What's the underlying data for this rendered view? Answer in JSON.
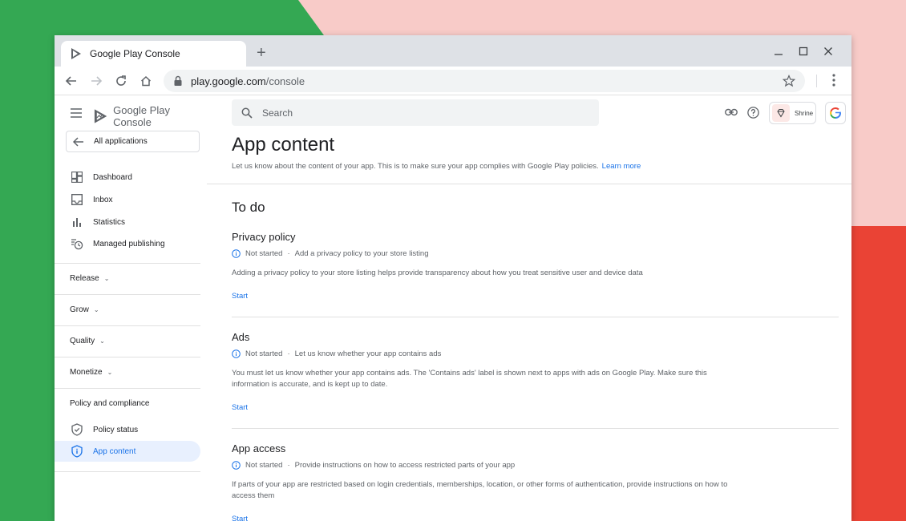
{
  "browser": {
    "tab_title": "Google Play Console",
    "url_host": "play.google.com",
    "url_path": "/console"
  },
  "sidebar": {
    "brand_prefix": "Google Play",
    "brand_suffix": "Console",
    "all_apps": "All applications",
    "top_items": [
      {
        "label": "Dashboard",
        "icon": "dashboard-icon"
      },
      {
        "label": "Inbox",
        "icon": "inbox-icon"
      },
      {
        "label": "Statistics",
        "icon": "bar-chart-icon"
      },
      {
        "label": "Managed publishing",
        "icon": "schedule-icon"
      }
    ],
    "sections": [
      "Release",
      "Grow",
      "Quality",
      "Monetize"
    ],
    "policy_section": "Policy and compliance",
    "policy_items": [
      {
        "label": "Policy status",
        "icon": "shield-check-icon"
      },
      {
        "label": "App content",
        "icon": "shield-info-icon",
        "active": true
      }
    ]
  },
  "header": {
    "search_placeholder": "Search",
    "account_name": "Shrine"
  },
  "main": {
    "title": "App content",
    "description": "Let us know about the content of your app. This is to make sure your app complies with Google Play policies.",
    "learn_more": "Learn more",
    "todo_heading": "To do",
    "cards": [
      {
        "title": "Privacy policy",
        "status": "Not started",
        "summary": "Add a privacy policy to your store listing",
        "description": "Adding a privacy policy to your store listing helps provide transparency about how you treat sensitive user and device data",
        "action": "Start"
      },
      {
        "title": "Ads",
        "status": "Not started",
        "summary": "Let us know whether your app contains ads",
        "description": "You must let us know whether your app contains ads. The 'Contains ads' label is shown next to apps with ads on Google Play. Make sure this information is accurate, and is kept up to date.",
        "action": "Start"
      },
      {
        "title": "App access",
        "status": "Not started",
        "summary": "Provide instructions on how to access restricted parts of your app",
        "description": "If parts of your app are restricted based on login credentials, memberships, location, or other forms of authentication, provide instructions on how to access them",
        "action": "Start"
      }
    ]
  },
  "colors": {
    "accent": "#1a73e8",
    "active_bg": "#e8f0fe",
    "bg_green": "#34a853",
    "bg_pink": "#f8cbc8",
    "bg_red": "#ea4335"
  }
}
